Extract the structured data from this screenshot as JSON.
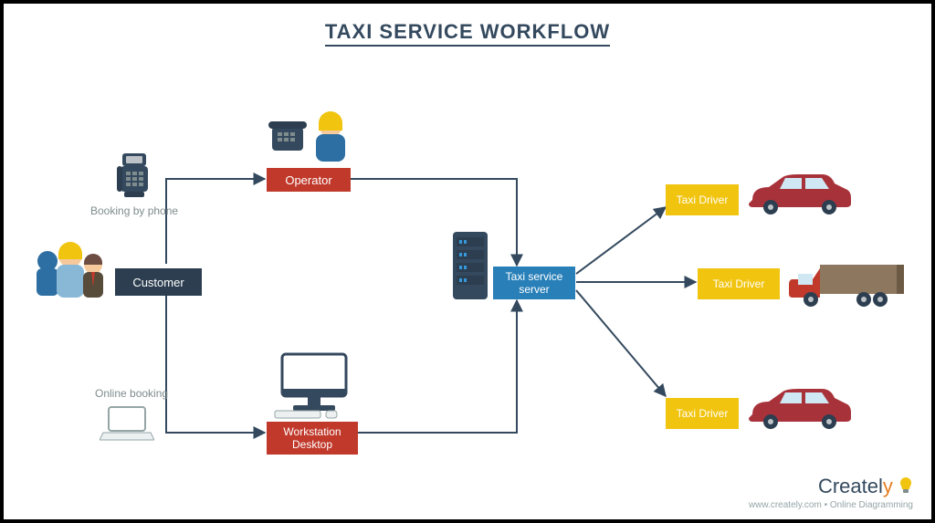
{
  "title": "TAXI SERVICE WORKFLOW",
  "nodes": {
    "customer": "Customer",
    "operator": "Operator",
    "workstation": "Workstation Desktop",
    "server": "Taxi service server",
    "driver1": "Taxi Driver",
    "driver2": "Taxi Driver",
    "driver3": "Taxi Driver"
  },
  "edges": {
    "booking_phone": "Booking by phone",
    "online_booking": "Online booking"
  },
  "footer": {
    "brand_plain": "Createl",
    "brand_accent": "y",
    "sub": "www.creately.com • Online Diagramming"
  }
}
